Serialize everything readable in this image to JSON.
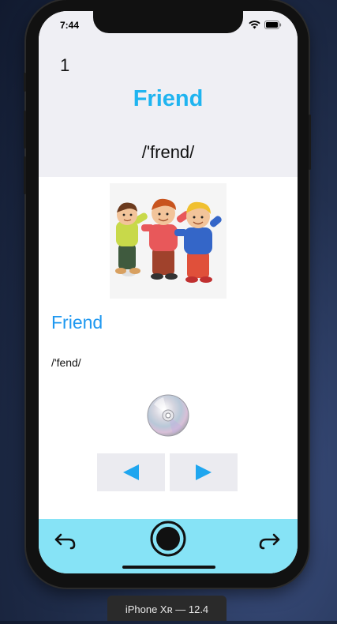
{
  "status_bar": {
    "time": "7:44"
  },
  "header": {
    "index": "1",
    "title": "Friend",
    "phonetic": "/'frend/"
  },
  "content": {
    "word": "Friend",
    "phonetic": "/'fend/"
  },
  "controls": {
    "previous_icon": "triangle-left-icon",
    "next_icon": "triangle-right-icon",
    "audio_icon": "cd-disc-icon"
  },
  "toolbar": {
    "back_icon": "undo-arrow-icon",
    "record_icon": "record-icon",
    "forward_icon": "redo-arrow-icon"
  },
  "colors": {
    "title": "#1fb4f0",
    "word": "#1e98f0",
    "nav_arrow": "#1fa6ef",
    "toolbar_bg": "#86e3f6",
    "header_bg": "#efeff4"
  },
  "simulator": {
    "label": "iPhone Xʀ — 12.4"
  }
}
